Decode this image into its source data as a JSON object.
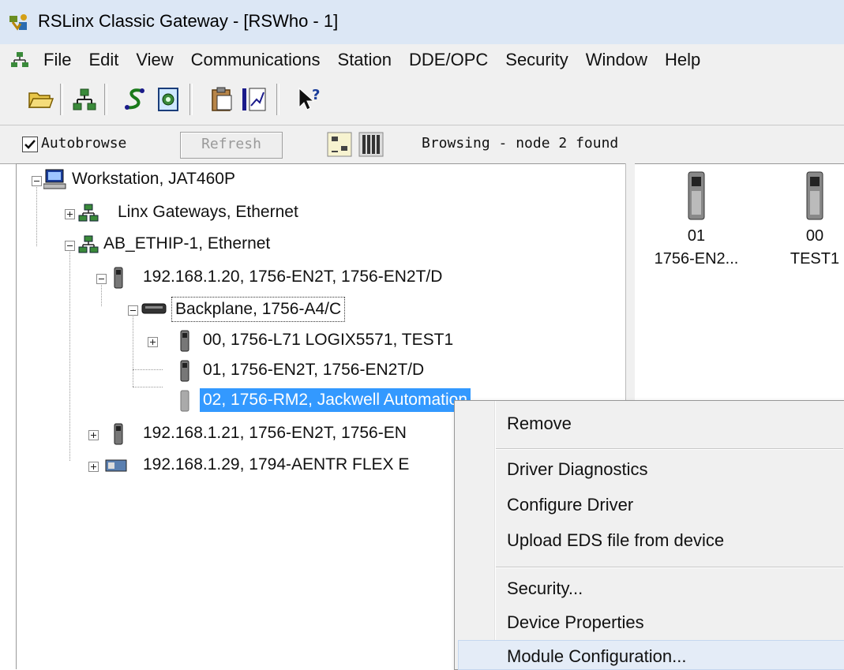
{
  "window": {
    "title": "RSLinx Classic Gateway - [RSWho - 1]"
  },
  "menubar": {
    "items": [
      "File",
      "Edit",
      "View",
      "Communications",
      "Station",
      "DDE/OPC",
      "Security",
      "Window",
      "Help"
    ]
  },
  "toolbar": {
    "buttons": [
      "open-icon",
      "rswho-icon",
      "driver-icon",
      "diagnostics-icon",
      "clipboard-icon",
      "trend-icon",
      "help-pointer-icon"
    ]
  },
  "browse": {
    "autobrowse_label": "Autobrowse",
    "autobrowse_checked": true,
    "refresh_label": "Refresh",
    "status": "Browsing - node 2 found"
  },
  "tree": {
    "root": "Workstation, JAT460P",
    "linx_gateways": "Linx Gateways, Ethernet",
    "driver": "AB_ETHIP-1, Ethernet",
    "node1": "192.168.1.20, 1756-EN2T, 1756-EN2T/D",
    "backplane": "Backplane, 1756-A4/C",
    "slot0": "00, 1756-L71 LOGIX5571, TEST1",
    "slot1": "01, 1756-EN2T, 1756-EN2T/D",
    "slot2": "02, 1756-RM2, Jackwell Automation",
    "node2": "192.168.1.21, 1756-EN2T, 1756-EN",
    "node3": "192.168.1.29, 1794-AENTR FLEX E"
  },
  "device_tiles": [
    {
      "number": "01",
      "name": "1756-EN2..."
    },
    {
      "number": "00",
      "name": "TEST1"
    }
  ],
  "context_menu": {
    "remove": "Remove",
    "driver_diagnostics": "Driver Diagnostics",
    "configure_driver": "Configure Driver",
    "upload_eds": "Upload EDS file from device",
    "security": "Security...",
    "device_properties": "Device Properties",
    "module_configuration": "Module Configuration..."
  },
  "colors": {
    "selection": "#3399ff",
    "menu_bg": "#f0f0f0",
    "title_bg": "#dce7f5"
  }
}
